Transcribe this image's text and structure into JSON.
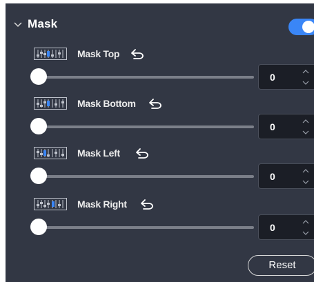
{
  "section": {
    "title": "Mask",
    "enabled": true
  },
  "controls": [
    {
      "label": "Mask Top",
      "value": "0",
      "level": 0
    },
    {
      "label": "Mask Bottom",
      "value": "0",
      "level": 0
    },
    {
      "label": "Mask Left",
      "value": "0",
      "level": 0
    },
    {
      "label": "Mask Right",
      "value": "0",
      "level": 0
    }
  ],
  "reset_label": "Reset",
  "colors": {
    "panel_bg": "#323744",
    "accent": "#3a86f7",
    "input_bg": "#1b1e26"
  }
}
